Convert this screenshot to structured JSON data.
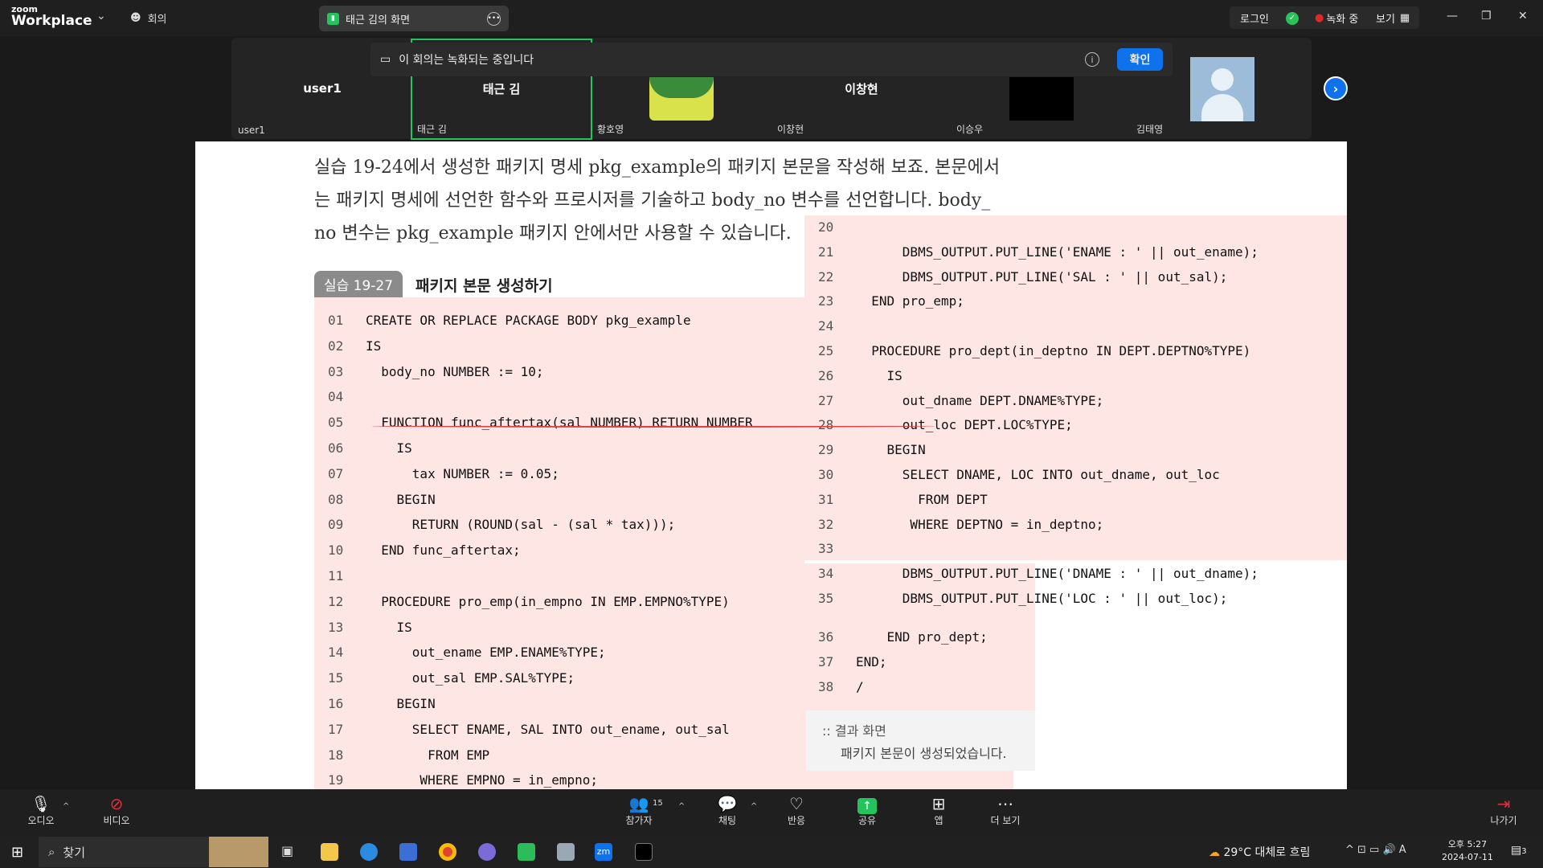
{
  "topbar": {
    "logo_line1": "zoom",
    "logo_line2": "Workplace",
    "meeting_label": "회의",
    "share_tab": "태근 김의 화면",
    "login": "로그인",
    "recording": "녹화 중",
    "view": "보기"
  },
  "notice": {
    "text": "이 회의는 녹화되는 중입니다",
    "ok": "확인"
  },
  "participants": [
    {
      "big": "user1",
      "name": "user1"
    },
    {
      "big": "태근 김",
      "name": "태근 김"
    },
    {
      "big": "",
      "name": "황호영"
    },
    {
      "big": "이창현",
      "name": "이창현"
    },
    {
      "big": "",
      "name": "이승우"
    },
    {
      "big": "",
      "name": "김태영"
    }
  ],
  "book": {
    "prose": [
      "실습 19-24에서 생성한 패키지 명세 pkg_example의 패키지 본문을 작성해 보죠. 본문에서",
      "는 패키지 명세에 선언한 함수와 프로시저를 기술하고 body_no 변수를 선언합니다. body_",
      "no 변수는 pkg_example 패키지 안에서만 사용할 수 있습니다."
    ],
    "ex_label": "실습 19-27",
    "ex_title": "패키지 본문 생성하기",
    "left_code": [
      {
        "n": "01",
        "t": "CREATE OR REPLACE PACKAGE BODY pkg_example"
      },
      {
        "n": "02",
        "t": "IS"
      },
      {
        "n": "03",
        "t": "  body_no NUMBER := 10;"
      },
      {
        "n": "04",
        "t": ""
      },
      {
        "n": "05",
        "t": "  FUNCTION func_aftertax(sal NUMBER) RETURN NUMBER"
      },
      {
        "n": "06",
        "t": "    IS"
      },
      {
        "n": "07",
        "t": "      tax NUMBER := 0.05;"
      },
      {
        "n": "08",
        "t": "    BEGIN"
      },
      {
        "n": "09",
        "t": "      RETURN (ROUND(sal - (sal * tax)));"
      },
      {
        "n": "10",
        "t": "  END func_aftertax;"
      },
      {
        "n": "11",
        "t": ""
      },
      {
        "n": "12",
        "t": "  PROCEDURE pro_emp(in_empno IN EMP.EMPNO%TYPE)"
      },
      {
        "n": "13",
        "t": "    IS"
      },
      {
        "n": "14",
        "t": "      out_ename EMP.ENAME%TYPE;"
      },
      {
        "n": "15",
        "t": "      out_sal EMP.SAL%TYPE;"
      },
      {
        "n": "16",
        "t": "    BEGIN"
      },
      {
        "n": "17",
        "t": "      SELECT ENAME, SAL INTO out_ename, out_sal"
      },
      {
        "n": "18",
        "t": "        FROM EMP"
      },
      {
        "n": "19",
        "t": "       WHERE EMPNO = in_empno;"
      }
    ],
    "right_code": [
      {
        "n": "20",
        "t": ""
      },
      {
        "n": "21",
        "t": "      DBMS_OUTPUT.PUT_LINE('ENAME : ' || out_ename);"
      },
      {
        "n": "22",
        "t": "      DBMS_OUTPUT.PUT_LINE('SAL : ' || out_sal);"
      },
      {
        "n": "23",
        "t": "  END pro_emp;"
      },
      {
        "n": "24",
        "t": ""
      },
      {
        "n": "25",
        "t": "  PROCEDURE pro_dept(in_deptno IN DEPT.DEPTNO%TYPE)"
      },
      {
        "n": "26",
        "t": "    IS"
      },
      {
        "n": "27",
        "t": "      out_dname DEPT.DNAME%TYPE;"
      },
      {
        "n": "28",
        "t": "      out_loc DEPT.LOC%TYPE;"
      },
      {
        "n": "29",
        "t": "    BEGIN"
      },
      {
        "n": "30",
        "t": "      SELECT DNAME, LOC INTO out_dname, out_loc"
      },
      {
        "n": "31",
        "t": "        FROM DEPT"
      },
      {
        "n": "32",
        "t": "       WHERE DEPTNO = in_deptno;"
      },
      {
        "n": "33",
        "t": ""
      },
      {
        "n": "34",
        "t": "      DBMS_OUTPUT.PUT_LINE('DNAME : ' || out_dname);"
      },
      {
        "n": "35",
        "t": "      DBMS_OUTPUT.PUT_LINE('LOC : ' || out_loc);"
      }
    ],
    "tail_code": [
      {
        "n": "36",
        "t": "    END pro_dept;"
      },
      {
        "n": "37",
        "t": "END;"
      },
      {
        "n": "38",
        "t": "/"
      }
    ],
    "result_heading": ":: 결과 화면",
    "result_body": "패키지 본문이 생성되었습니다."
  },
  "toolbar": {
    "audio": "오디오",
    "video": "비디오",
    "participants": "참가자",
    "participant_count": "15",
    "chat": "채팅",
    "react": "반응",
    "share": "공유",
    "apps": "앱",
    "more": "더 보기",
    "leave": "나가기"
  },
  "taskbar": {
    "search": "찾기",
    "weather": "29°C  대체로 흐림",
    "time": "오후 5:27",
    "date": "2024-07-11",
    "notif_count": "3"
  },
  "colors": {
    "accent": "#0e72ed",
    "code_bg": "#fde6e3",
    "share_green": "#23c45e"
  }
}
